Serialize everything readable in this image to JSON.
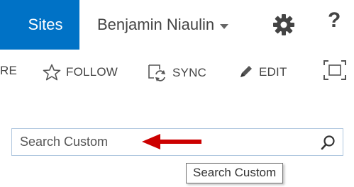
{
  "suite_bar": {
    "sites_label": "Sites",
    "user_name": "Benjamin Niaulin",
    "settings_icon": "gear-icon",
    "help_label": "?"
  },
  "action_bar": {
    "share_label": "RE",
    "follow_label": "FOLLOW",
    "sync_label": "SYNC",
    "edit_label": "EDIT"
  },
  "search": {
    "placeholder": "Search Custom",
    "tooltip": "Search Custom"
  },
  "colors": {
    "suite_accent": "#0072c6",
    "annotation_arrow": "#cc0000"
  }
}
